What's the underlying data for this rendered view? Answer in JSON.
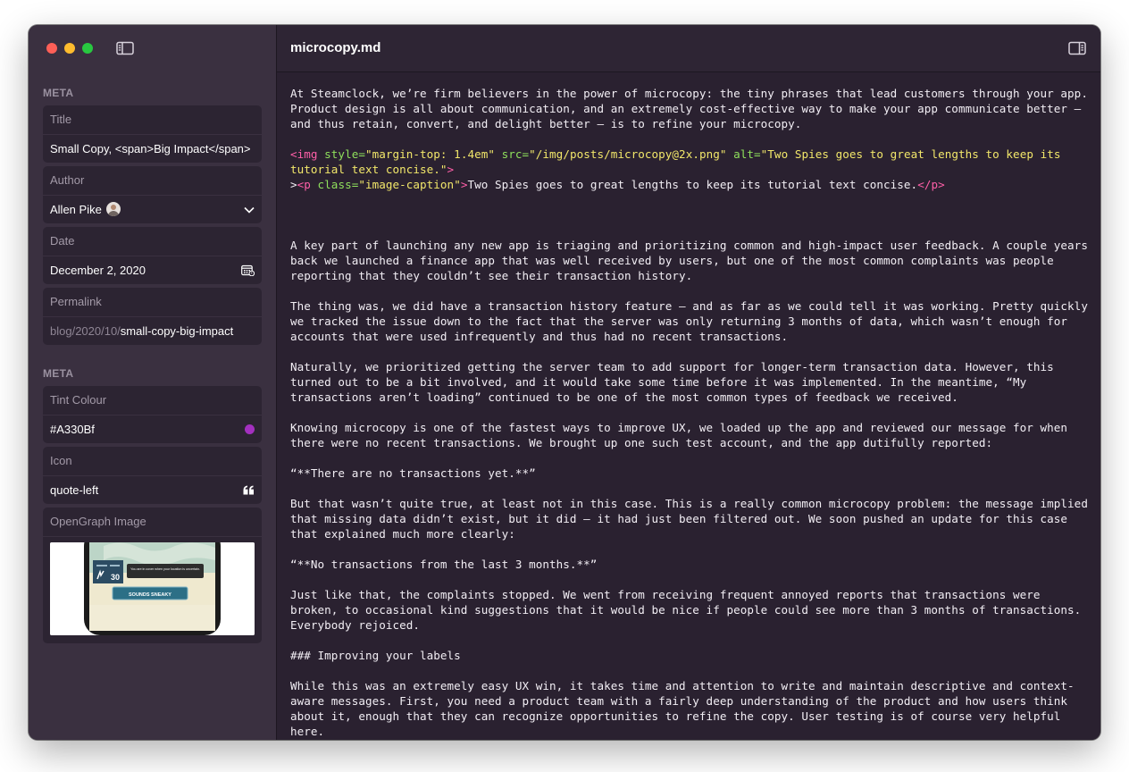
{
  "sidebar": {
    "section_meta_1": "META",
    "section_meta_2": "META",
    "title": {
      "label": "Title",
      "value": "Small Copy, <span>Big Impact</span>"
    },
    "author": {
      "label": "Author",
      "value": "Allen Pike"
    },
    "date": {
      "label": "Date",
      "value": "December 2, 2020"
    },
    "permalink": {
      "label": "Permalink",
      "prefix": "blog/2020/10/",
      "slug": "small-copy-big-impact"
    },
    "tint": {
      "label": "Tint Colour",
      "value": "#A330Bf",
      "color": "#A330BF"
    },
    "icon": {
      "label": "Icon",
      "value": "quote-left",
      "glyph": "quote-left-icon"
    },
    "og": {
      "label": "OpenGraph Image",
      "phone_stat_1": "30",
      "phone_text": "You are in cover when your location is uncertain.",
      "phone_button": "SOUNDS SNEAKY"
    }
  },
  "document": {
    "title": "microcopy.md",
    "p1": "At Steamclock, we’re firm believers in the power of microcopy: the tiny phrases that lead customers through your app. Product design is all about communication, and an extremely cost-effective way to make your app communicate better – and thus retain, convert, and delight better – is to refine your microcopy.",
    "img": {
      "open": "<img",
      "style_attr": "style=",
      "style_val": "\"margin-top: 1.4em\"",
      "src_attr": "src=",
      "src_val": "\"/img/posts/microcopy@2x.png\"",
      "alt_attr": "alt=",
      "alt_val": "\"Two Spies goes to great lengths to keep its tutorial text concise.\"",
      "close": ">"
    },
    "caption": {
      "lead": ">",
      "open": "<p",
      "class_attr": "class=",
      "class_val": "\"image-caption\"",
      "open_close": ">",
      "text": "Two Spies goes to great lengths to keep its tutorial text concise.",
      "end": "</p>"
    },
    "p2": "A key part of launching any new app is triaging and prioritizing common and high-impact user feedback. A couple years back we launched a finance app that was well received by users, but one of the most common complaints was people reporting that they couldn’t see their transaction history.",
    "p3": "The thing was, we did have a transaction history feature – and as far as we could tell it was working. Pretty quickly we tracked the issue down to the fact that the server was only returning 3 months of data, which wasn’t enough for accounts that were used infrequently and thus had no recent transactions.",
    "p4": "Naturally, we prioritized getting the server team to add support for longer-term transaction data. However, this turned out to be a bit involved, and it would take some time before it was implemented. In the meantime, “My transactions aren’t loading” continued to be one of the most common types of feedback we received.",
    "p5": "Knowing microcopy is one of the fastest ways to improve UX, we loaded up the app and reviewed our message for when there were no recent transactions. We brought up one such test account, and the app dutifully reported:",
    "p6": "“**There are no transactions yet.**”",
    "p7": "But that wasn’t quite true, at least not in this case. This is a really common microcopy problem: the message implied that missing data didn’t exist, but it did – it had just been filtered out. We soon pushed an update for this case that explained much more clearly:",
    "p8": "“**No transactions from the last 3 months.**”",
    "p9": "Just like that, the complaints stopped. We went from receiving frequent annoyed reports that transactions were broken, to occasional kind suggestions that it would be nice if people could see more than 3 months of transactions. Everybody rejoiced.",
    "p10": "### Improving your labels",
    "p11": "While this was an extremely easy UX win, it takes time and attention to write and maintain descriptive and context-aware messages. First, you need a product team with a fairly deep understanding of the product and how users think about it, enough that they can recognize opportunities to refine the copy. User testing is of course very helpful here."
  },
  "colors": {
    "accent": "#A330BF",
    "window_bg": "#2A2130",
    "sidebar_bg": "#3A3040",
    "tag": "#FF5FA8",
    "attr": "#8FE05C",
    "string": "#F2E76A"
  }
}
